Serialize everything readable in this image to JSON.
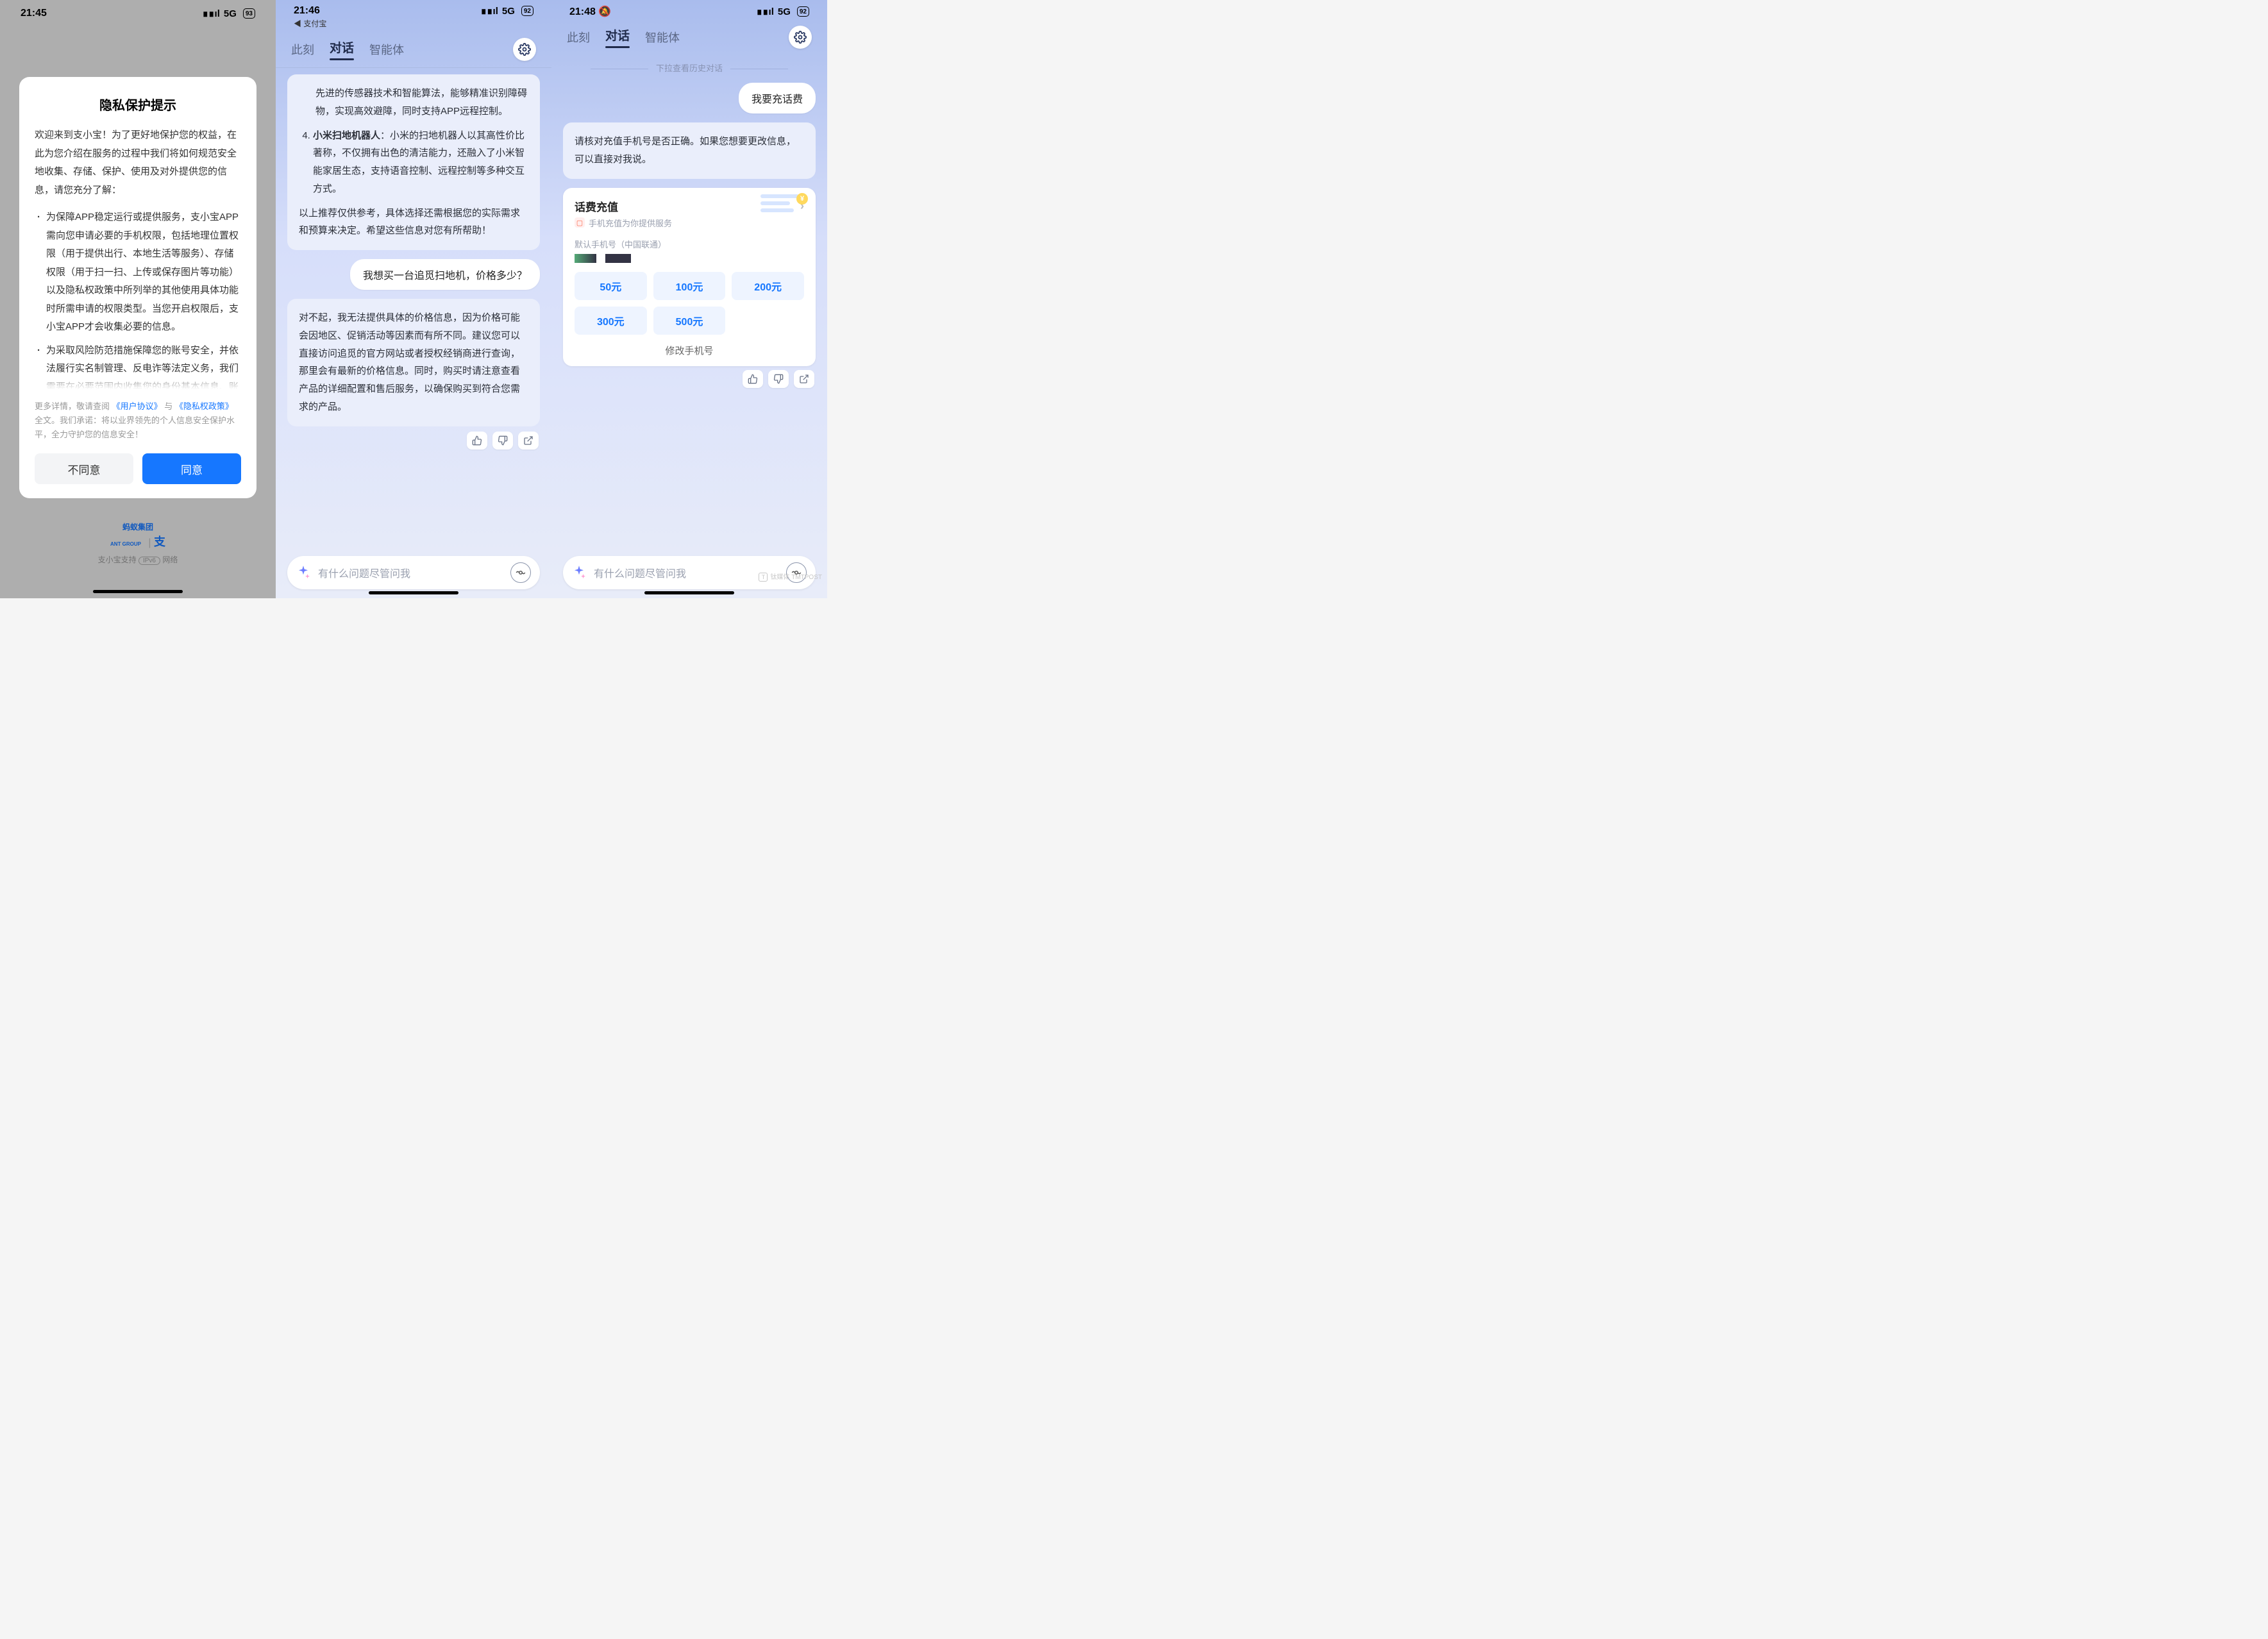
{
  "phone1": {
    "status": {
      "time": "21:45",
      "signal": "5G",
      "battery": "93"
    },
    "dialog": {
      "title": "隐私保护提示",
      "intro": "欢迎来到支小宝！为了更好地保护您的权益，在此为您介绍在服务的过程中我们将如何规范安全地收集、存储、保护、使用及对外提供您的信息，请您充分了解：",
      "bullet1": "为保障APP稳定运行或提供服务，支小宝APP需向您申请必要的手机权限，包括地理位置权限（用于提供出行、本地生活等服务）、存储权限（用于扫一扫、上传或保存图片等功能）以及隐私权政策中所列举的其他使用具体功能时所需申请的权限类型。当您开启权限后，支小宝APP才会收集必要的信息。",
      "bullet2": "为采取风险防范措施保障您的账号安全，并依法履行实名制管理、反电诈等法定义务，我们需要在必要范围内收集您的身份基本信息、账号信息以及设备信息",
      "more_prefix": "更多详情，敬请查阅",
      "link1": "《用户协议》",
      "more_mid": "与",
      "link2": "《隐私权政策》",
      "more_suffix": "全文。我们承诺：将以业界领先的个人信息安全保护水平，全力守护您的信息安全！",
      "btn_disagree": "不同意",
      "btn_agree": "同意"
    },
    "brand": {
      "ant_zh": "蚂蚁集团",
      "ant_en": "ANT GROUP",
      "pay": "支",
      "ipv6": "支小宝支持 IPv6 网络"
    }
  },
  "phone2": {
    "status": {
      "time": "21:46",
      "back": "◀ 支付宝",
      "signal": "5G",
      "battery": "92"
    },
    "tabs": {
      "t1": "此刻",
      "t2": "对话",
      "t3": "智能体"
    },
    "msg1_pre": "先进的传感器技术和智能算法，能够精准识别障碍物，实现高效避障，同时支持APP远程控制。",
    "msg1_item4_title": "小米扫地机器人",
    "msg1_item4_body": "：小米的扫地机器人以其高性价比著称，不仅拥有出色的清洁能力，还融入了小米智能家居生态，支持语音控制、远程控制等多种交互方式。",
    "msg1_tail": "以上推荐仅供参考，具体选择还需根据您的实际需求和预算来决定。希望这些信息对您有所帮助！",
    "user_msg": "我想买一台追觅扫地机，价格多少？",
    "msg2": "对不起，我无法提供具体的价格信息，因为价格可能会因地区、促销活动等因素而有所不同。建议您可以直接访问追觅的官方网站或者授权经销商进行查询，那里会有最新的价格信息。同时，购买时请注意查看产品的详细配置和售后服务，以确保购买到符合您需求的产品。",
    "input_placeholder": "有什么问题尽管问我"
  },
  "phone3": {
    "status": {
      "time": "21:48",
      "signal": "5G",
      "battery": "92"
    },
    "tabs": {
      "t1": "此刻",
      "t2": "对话",
      "t3": "智能体"
    },
    "history_hint": "下拉查看历史对话",
    "user_msg": "我要充话费",
    "bot_msg": "请核对充值手机号是否正确。如果您想要更改信息，可以直接对我说。",
    "card": {
      "title": "话费充值",
      "subtitle": "手机充值为你提供服务",
      "field_label": "默认手机号（中国联通）",
      "amounts": [
        "50元",
        "100元",
        "200元",
        "300元",
        "500元"
      ],
      "modify": "修改手机号"
    },
    "input_placeholder": "有什么问题尽管问我",
    "watermark": "钛媒体\nTMTPOST"
  }
}
